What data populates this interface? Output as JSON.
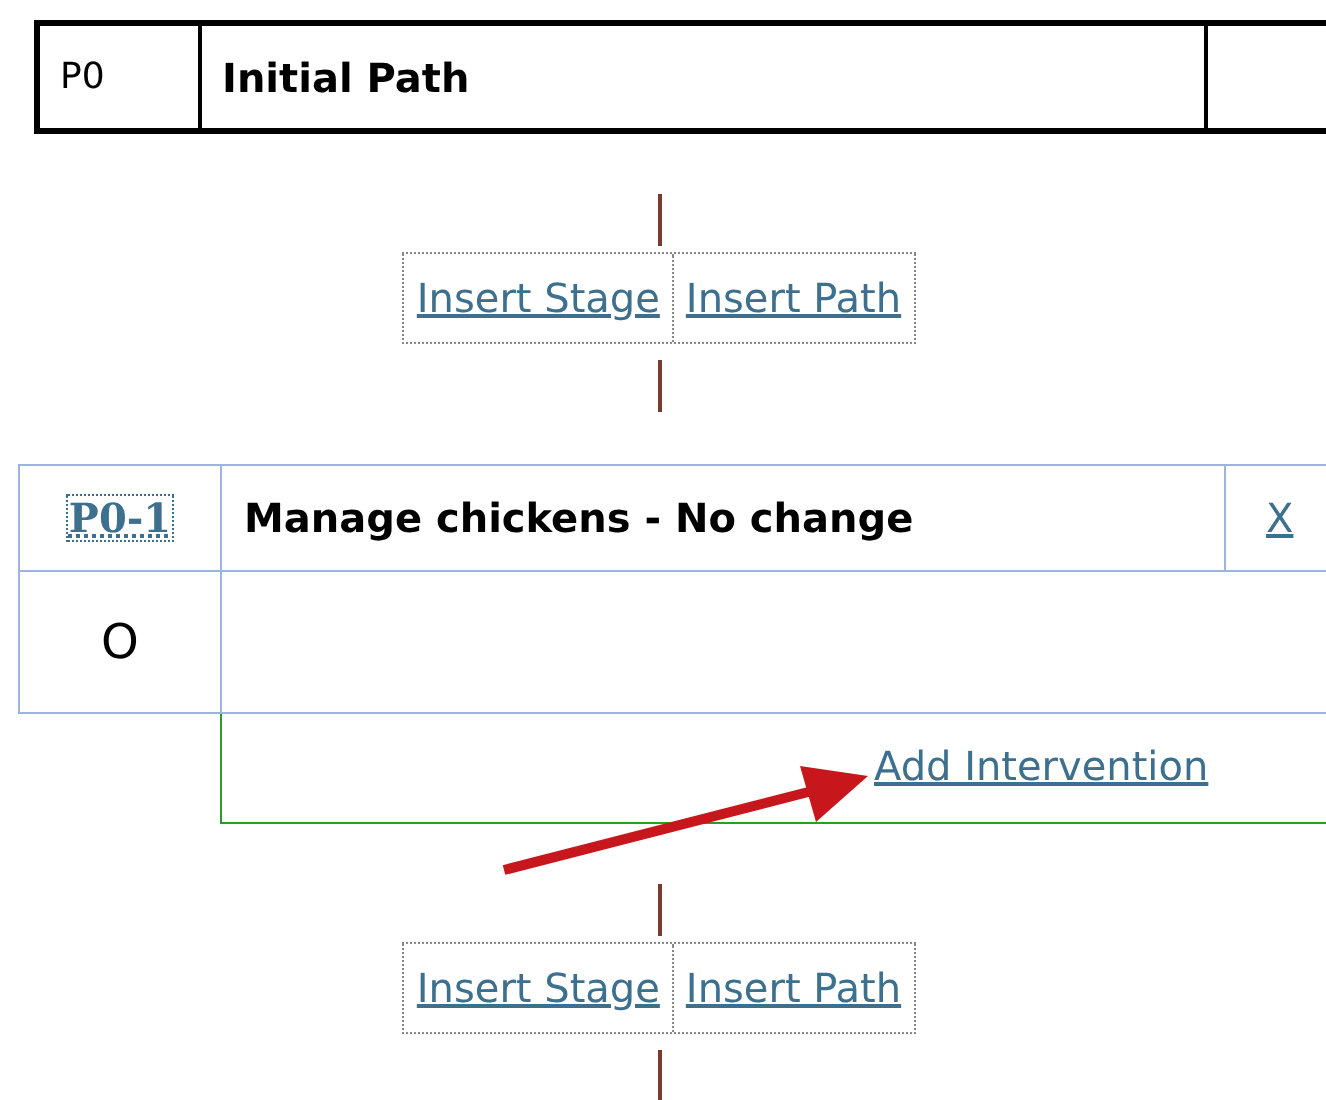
{
  "path": {
    "id": "P0",
    "title": "Initial Path"
  },
  "insert_links_top": [
    "Insert Stage",
    "Insert Path"
  ],
  "stage": {
    "id": "P0-1",
    "title": "Manage chickens - No change",
    "remove": "X",
    "marker": "O"
  },
  "add_link": "Add Intervention",
  "insert_links_bottom": [
    "Insert Stage",
    "Insert Path"
  ]
}
